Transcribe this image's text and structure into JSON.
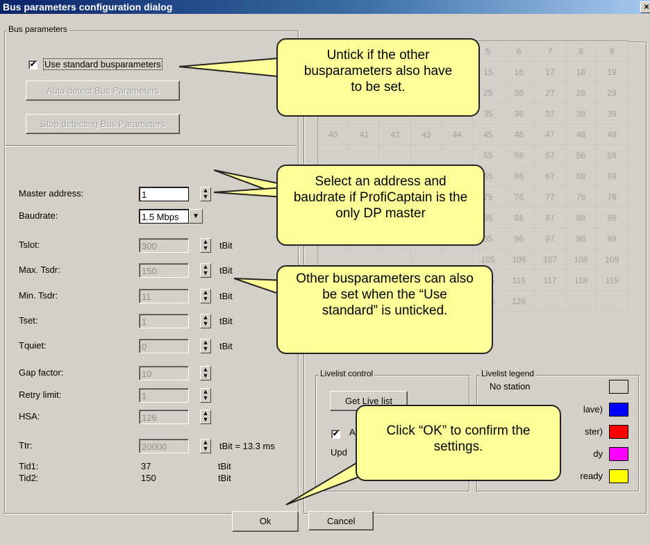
{
  "window": {
    "title": "Bus parameters configuration dialog",
    "close_label": "×"
  },
  "bus_group": {
    "label": "Bus parameters",
    "use_standard": {
      "label": "Use standard busparameters",
      "checked": true,
      "mark": "✔"
    },
    "auto_detect_label": "Auto detect Bus Parameters",
    "stop_detect_label": "Stop detecting Bus Parameters"
  },
  "params": [
    {
      "label": "Master address:",
      "value": "1",
      "unit": "",
      "kind": "spin",
      "enabled": true
    },
    {
      "label": "Baudrate:",
      "value": "1.5 Mbps",
      "unit": "",
      "kind": "combo",
      "enabled": true
    },
    {
      "label": "Tslot:",
      "value": "300",
      "unit": "tBit",
      "kind": "spin",
      "enabled": false
    },
    {
      "label": "Max. Tsdr:",
      "value": "150",
      "unit": "tBit",
      "kind": "spin",
      "enabled": false
    },
    {
      "label": "Min. Tsdr:",
      "value": "11",
      "unit": "tBit",
      "kind": "spin",
      "enabled": false
    },
    {
      "label": "Tset:",
      "value": "1",
      "unit": "tBit",
      "kind": "spin",
      "enabled": false
    },
    {
      "label": "Tquiet:",
      "value": "0",
      "unit": "tBit",
      "kind": "spin",
      "enabled": false
    },
    {
      "label": "Gap factor:",
      "value": "10",
      "unit": "",
      "kind": "spin",
      "enabled": false
    },
    {
      "label": "Retry limit:",
      "value": "1",
      "unit": "",
      "kind": "spin",
      "enabled": false
    },
    {
      "label": "HSA:",
      "value": "126",
      "unit": "",
      "kind": "spin",
      "enabled": false
    },
    {
      "label": "Ttr:",
      "value": "20000",
      "unit": "tBit = 13.3 ms",
      "kind": "spin",
      "enabled": false
    }
  ],
  "tid": [
    {
      "label": "Tid1:",
      "value": "37",
      "unit": "tBit"
    },
    {
      "label": "Tid2:",
      "value": "150",
      "unit": "tBit"
    }
  ],
  "station_grid": [
    "",
    "",
    "",
    "",
    "",
    "5",
    "6",
    "7",
    "8",
    "9",
    "",
    "",
    "",
    "",
    "",
    "15",
    "16",
    "17",
    "18",
    "19",
    "",
    "",
    "",
    "",
    "",
    "25",
    "26",
    "27",
    "28",
    "29",
    "30",
    "31",
    "32",
    "33",
    "34",
    "35",
    "36",
    "37",
    "38",
    "39",
    "40",
    "41",
    "42",
    "43",
    "44",
    "45",
    "46",
    "47",
    "48",
    "49",
    "",
    "",
    "",
    "",
    "",
    "55",
    "56",
    "57",
    "58",
    "59",
    "",
    "",
    "",
    "",
    "",
    "65",
    "66",
    "67",
    "68",
    "69",
    "",
    "",
    "",
    "",
    "",
    "75",
    "76",
    "77",
    "78",
    "79",
    "80",
    "81",
    "82",
    "83",
    "84",
    "85",
    "86",
    "87",
    "88",
    "89",
    "",
    "",
    "",
    "",
    "",
    "95",
    "96",
    "97",
    "98",
    "99",
    "",
    "",
    "",
    "",
    "",
    "105",
    "106",
    "107",
    "108",
    "109",
    "",
    "",
    "",
    "",
    "",
    "115",
    "116",
    "117",
    "118",
    "119",
    "",
    "",
    "",
    "",
    "",
    "125",
    "126",
    "",
    "",
    ""
  ],
  "livelist_control": {
    "label": "Livelist control",
    "get_button": "Get Live list",
    "auto": {
      "label": "A",
      "checked": true,
      "mark": "✔"
    },
    "update_label": "Upd"
  },
  "livelist_legend": {
    "label": "Livelist legend",
    "items": [
      {
        "label": "No station",
        "color": "#d4d0c8"
      },
      {
        "label": "lave)",
        "color": "#0000ff"
      },
      {
        "label": "ster)",
        "color": "#ff0000"
      },
      {
        "label": "dy",
        "color": "#ff00ff"
      },
      {
        "label": "ready",
        "color": "#ffff00"
      }
    ]
  },
  "footer": {
    "ok_label": "Ok",
    "cancel_label": "Cancel"
  },
  "callouts": [
    {
      "id": "untick",
      "text": "Untick if the other busparameters also have to be set."
    },
    {
      "id": "address",
      "text": "Select an address and baudrate if ProfiCaptain is the only DP master"
    },
    {
      "id": "other",
      "text": "Other busparameters can also be set when the “Use standard” is unticked."
    },
    {
      "id": "ok",
      "text": "Click “OK” to confirm the settings."
    }
  ],
  "colors": {
    "callout_fill": "#ffff99",
    "title_bar": "#0a246a",
    "dialog_bg": "#d4d0c8"
  }
}
